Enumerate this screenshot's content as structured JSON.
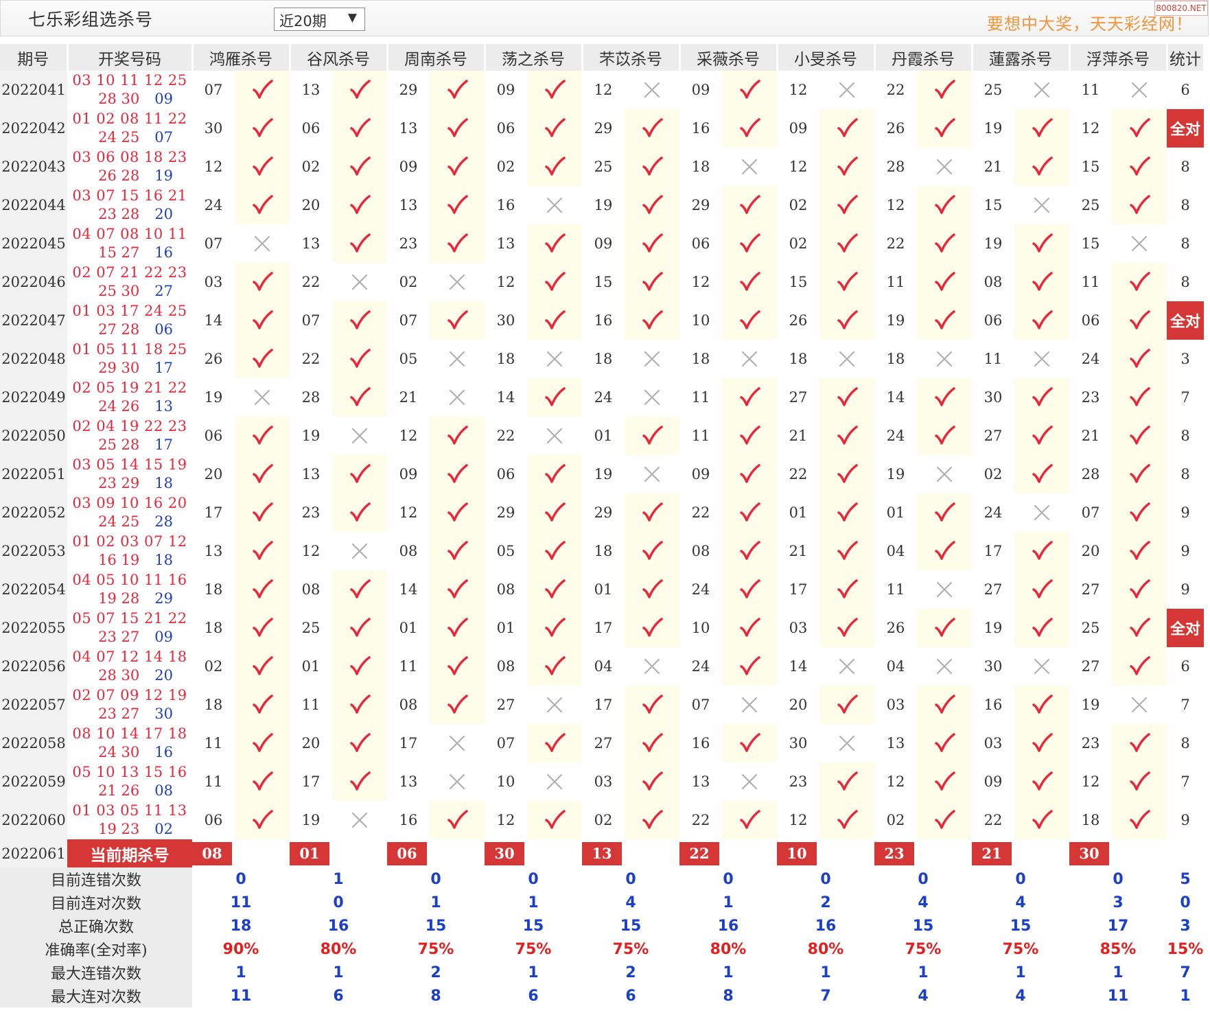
{
  "header": {
    "title": "七乐彩组选杀号",
    "select_value": "近20期",
    "select_arrow": "▼",
    "slogan": "要想中大奖，天天彩经网！",
    "site_badge": "800820.NET"
  },
  "columns": {
    "period": "期号",
    "draw": "开奖号码",
    "experts": [
      "鸿雁杀号",
      "谷风杀号",
      "周南杀号",
      "荡之杀号",
      "芣苡杀号",
      "采薇杀号",
      "小旻杀号",
      "丹霞杀号",
      "蓮露杀号",
      "浮萍杀号"
    ],
    "stat": "统计"
  },
  "icons": {
    "hit": "red-check-icon",
    "miss": "gray-cross-icon"
  },
  "colors": {
    "accent": "#d53737",
    "hit_bg": "#fdfde9",
    "check": "#e8283a",
    "cross": "#b0b0b0",
    "blue_num": "#2040c0"
  },
  "rows": [
    {
      "period": "2022041",
      "red": "03 10 11 12 25",
      "red2": "28 30",
      "blue": "09",
      "kills": [
        "07",
        "13",
        "29",
        "09",
        "12",
        "09",
        "12",
        "22",
        "25",
        "11"
      ],
      "hits": [
        1,
        1,
        1,
        1,
        0,
        1,
        0,
        1,
        0,
        0
      ],
      "stat": "6"
    },
    {
      "period": "2022042",
      "red": "01 02 08 11 22",
      "red2": "24 25",
      "blue": "07",
      "kills": [
        "30",
        "06",
        "13",
        "06",
        "29",
        "16",
        "09",
        "26",
        "19",
        "12"
      ],
      "hits": [
        1,
        1,
        1,
        1,
        1,
        1,
        1,
        1,
        1,
        1
      ],
      "stat": "全对"
    },
    {
      "period": "2022043",
      "red": "03 06 08 18 23",
      "red2": "26 28",
      "blue": "19",
      "kills": [
        "12",
        "02",
        "09",
        "02",
        "25",
        "18",
        "12",
        "28",
        "21",
        "15"
      ],
      "hits": [
        1,
        1,
        1,
        1,
        1,
        0,
        1,
        0,
        1,
        1
      ],
      "stat": "8"
    },
    {
      "period": "2022044",
      "red": "03 07 15 16 21",
      "red2": "23 28",
      "blue": "20",
      "kills": [
        "24",
        "20",
        "13",
        "16",
        "19",
        "29",
        "02",
        "12",
        "15",
        "25"
      ],
      "hits": [
        1,
        1,
        1,
        0,
        1,
        1,
        1,
        1,
        0,
        1
      ],
      "stat": "8"
    },
    {
      "period": "2022045",
      "red": "04 07 08 10 11",
      "red2": "15 27",
      "blue": "16",
      "kills": [
        "07",
        "13",
        "23",
        "13",
        "09",
        "06",
        "02",
        "22",
        "19",
        "15"
      ],
      "hits": [
        0,
        1,
        1,
        1,
        1,
        1,
        1,
        1,
        1,
        0
      ],
      "stat": "8"
    },
    {
      "period": "2022046",
      "red": "02 07 21 22 23",
      "red2": "25 30",
      "blue": "27",
      "kills": [
        "03",
        "22",
        "02",
        "12",
        "15",
        "12",
        "15",
        "11",
        "08",
        "11"
      ],
      "hits": [
        1,
        0,
        0,
        1,
        1,
        1,
        1,
        1,
        1,
        1
      ],
      "stat": "8"
    },
    {
      "period": "2022047",
      "red": "01 03 17 24 25",
      "red2": "27 28",
      "blue": "06",
      "kills": [
        "14",
        "07",
        "07",
        "30",
        "16",
        "10",
        "26",
        "19",
        "06",
        "06"
      ],
      "hits": [
        1,
        1,
        1,
        1,
        1,
        1,
        1,
        1,
        1,
        1
      ],
      "stat": "全对"
    },
    {
      "period": "2022048",
      "red": "01 05 11 18 25",
      "red2": "29 30",
      "blue": "17",
      "kills": [
        "26",
        "22",
        "05",
        "18",
        "18",
        "18",
        "18",
        "18",
        "11",
        "24"
      ],
      "hits": [
        1,
        1,
        0,
        0,
        0,
        0,
        0,
        0,
        0,
        1
      ],
      "stat": "3"
    },
    {
      "period": "2022049",
      "red": "02 05 19 21 22",
      "red2": "24 26",
      "blue": "13",
      "kills": [
        "19",
        "28",
        "21",
        "14",
        "24",
        "11",
        "27",
        "14",
        "30",
        "23"
      ],
      "hits": [
        0,
        1,
        0,
        1,
        0,
        1,
        1,
        1,
        1,
        1
      ],
      "stat": "7"
    },
    {
      "period": "2022050",
      "red": "02 04 19 22 23",
      "red2": "25 28",
      "blue": "17",
      "kills": [
        "06",
        "19",
        "12",
        "22",
        "01",
        "11",
        "21",
        "24",
        "27",
        "21"
      ],
      "hits": [
        1,
        0,
        1,
        0,
        1,
        1,
        1,
        1,
        1,
        1
      ],
      "stat": "8"
    },
    {
      "period": "2022051",
      "red": "03 05 14 15 19",
      "red2": "23 29",
      "blue": "18",
      "kills": [
        "20",
        "13",
        "09",
        "06",
        "19",
        "09",
        "22",
        "19",
        "02",
        "28"
      ],
      "hits": [
        1,
        1,
        1,
        1,
        0,
        1,
        1,
        0,
        1,
        1
      ],
      "stat": "8"
    },
    {
      "period": "2022052",
      "red": "03 09 10 16 20",
      "red2": "24 25",
      "blue": "28",
      "kills": [
        "17",
        "23",
        "12",
        "29",
        "29",
        "22",
        "01",
        "01",
        "24",
        "07"
      ],
      "hits": [
        1,
        1,
        1,
        1,
        1,
        1,
        1,
        1,
        0,
        1
      ],
      "stat": "9"
    },
    {
      "period": "2022053",
      "red": "01 02 03 07 12",
      "red2": "16 19",
      "blue": "18",
      "kills": [
        "13",
        "12",
        "08",
        "05",
        "18",
        "08",
        "21",
        "04",
        "17",
        "20"
      ],
      "hits": [
        1,
        0,
        1,
        1,
        1,
        1,
        1,
        1,
        1,
        1
      ],
      "stat": "9"
    },
    {
      "period": "2022054",
      "red": "04 05 10 11 16",
      "red2": "19 28",
      "blue": "29",
      "kills": [
        "18",
        "08",
        "14",
        "08",
        "01",
        "24",
        "17",
        "11",
        "27",
        "27"
      ],
      "hits": [
        1,
        1,
        1,
        1,
        1,
        1,
        1,
        0,
        1,
        1
      ],
      "stat": "9"
    },
    {
      "period": "2022055",
      "red": "05 07 15 21 22",
      "red2": "23 27",
      "blue": "09",
      "kills": [
        "18",
        "25",
        "01",
        "01",
        "17",
        "10",
        "03",
        "26",
        "19",
        "25"
      ],
      "hits": [
        1,
        1,
        1,
        1,
        1,
        1,
        1,
        1,
        1,
        1
      ],
      "stat": "全对"
    },
    {
      "period": "2022056",
      "red": "04 07 12 14 18",
      "red2": "28 30",
      "blue": "20",
      "kills": [
        "02",
        "01",
        "11",
        "08",
        "04",
        "24",
        "14",
        "04",
        "30",
        "27"
      ],
      "hits": [
        1,
        1,
        1,
        1,
        0,
        1,
        0,
        0,
        0,
        1
      ],
      "stat": "6"
    },
    {
      "period": "2022057",
      "red": "02 07 09 12 19",
      "red2": "23 27",
      "blue": "30",
      "kills": [
        "18",
        "11",
        "08",
        "27",
        "17",
        "07",
        "20",
        "03",
        "16",
        "19"
      ],
      "hits": [
        1,
        1,
        1,
        0,
        1,
        0,
        1,
        1,
        1,
        0
      ],
      "stat": "7"
    },
    {
      "period": "2022058",
      "red": "08 10 14 17 18",
      "red2": "24 30",
      "blue": "16",
      "kills": [
        "11",
        "20",
        "17",
        "07",
        "27",
        "16",
        "30",
        "13",
        "03",
        "23"
      ],
      "hits": [
        1,
        1,
        0,
        1,
        1,
        1,
        0,
        1,
        1,
        1
      ],
      "stat": "8"
    },
    {
      "period": "2022059",
      "red": "05 10 13 15 16",
      "red2": "21 26",
      "blue": "08",
      "kills": [
        "11",
        "17",
        "13",
        "10",
        "03",
        "13",
        "23",
        "12",
        "09",
        "12"
      ],
      "hits": [
        1,
        1,
        0,
        0,
        1,
        0,
        1,
        1,
        1,
        1
      ],
      "stat": "7"
    },
    {
      "period": "2022060",
      "red": "01 03 05 11 13",
      "red2": "19 23",
      "blue": "02",
      "kills": [
        "06",
        "19",
        "16",
        "12",
        "02",
        "22",
        "12",
        "02",
        "22",
        "18"
      ],
      "hits": [
        1,
        0,
        1,
        1,
        1,
        1,
        1,
        1,
        1,
        1
      ],
      "stat": "9"
    }
  ],
  "current": {
    "period": "2022061",
    "label": "当前期杀号",
    "kills": [
      "08",
      "01",
      "06",
      "30",
      "13",
      "22",
      "10",
      "23",
      "21",
      "30"
    ]
  },
  "summary": [
    {
      "label": "目前连错次数",
      "values": [
        "0",
        "1",
        "0",
        "0",
        "0",
        "0",
        "0",
        "0",
        "0",
        "0"
      ],
      "stat": "5",
      "rate": false
    },
    {
      "label": "目前连对次数",
      "values": [
        "11",
        "0",
        "1",
        "1",
        "4",
        "1",
        "2",
        "4",
        "4",
        "3"
      ],
      "stat": "0",
      "rate": false
    },
    {
      "label": "总正确次数",
      "values": [
        "18",
        "16",
        "15",
        "15",
        "15",
        "16",
        "16",
        "15",
        "15",
        "17"
      ],
      "stat": "3",
      "rate": false
    },
    {
      "label": "准确率(全对率)",
      "values": [
        "90%",
        "80%",
        "75%",
        "75%",
        "75%",
        "80%",
        "80%",
        "75%",
        "75%",
        "85%"
      ],
      "stat": "15%",
      "rate": true
    },
    {
      "label": "最大连错次数",
      "values": [
        "1",
        "1",
        "2",
        "1",
        "2",
        "1",
        "1",
        "1",
        "1",
        "1"
      ],
      "stat": "7",
      "rate": false
    },
    {
      "label": "最大连对次数",
      "values": [
        "11",
        "6",
        "8",
        "6",
        "6",
        "8",
        "7",
        "4",
        "4",
        "11"
      ],
      "stat": "1",
      "rate": false
    }
  ]
}
